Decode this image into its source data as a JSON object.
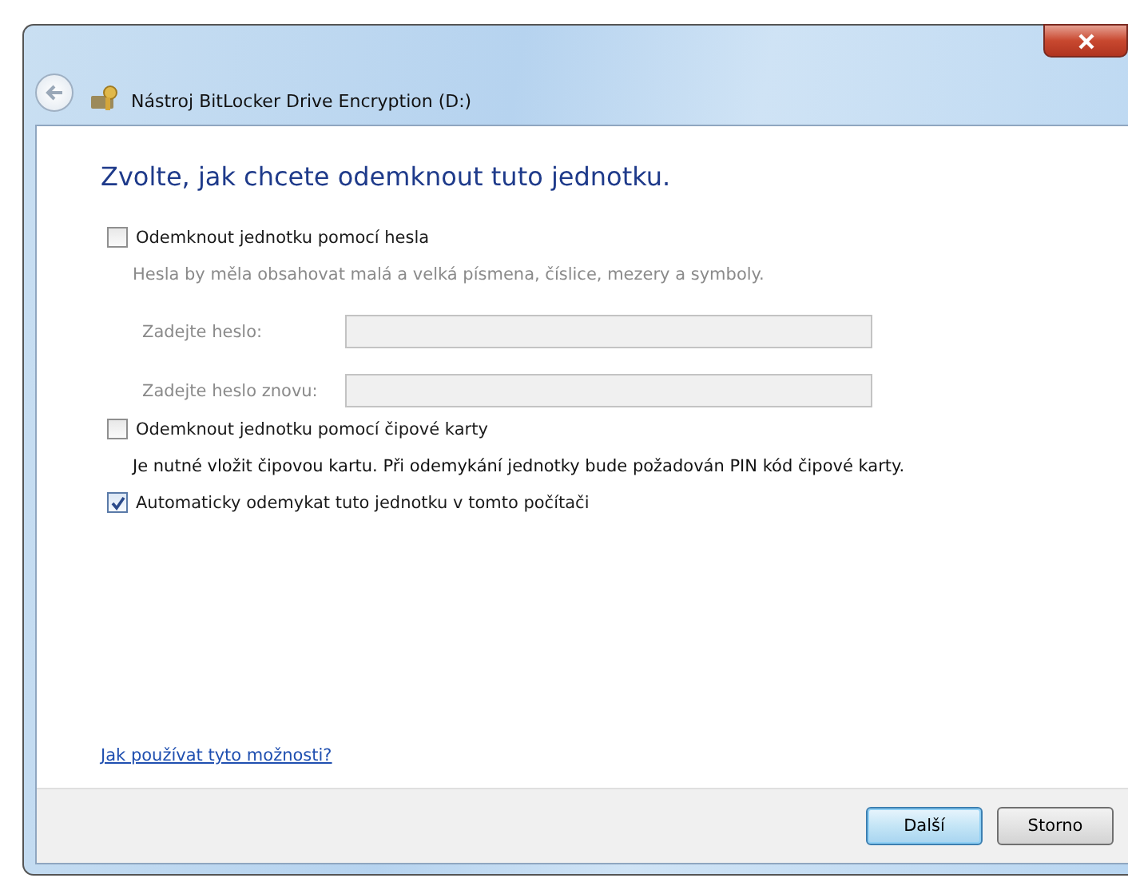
{
  "window": {
    "title": "Nástroj BitLocker Drive Encryption (D:)"
  },
  "heading": "Zvolte, jak chcete odemknout tuto jednotku.",
  "options": [
    {
      "label": "Odemknout jednotku pomocí hesla",
      "checked": false,
      "note": "Hesla by měla obsahovat malá a velká písmena, číslice, mezery a symboly.",
      "note_disabled": true,
      "fields": [
        {
          "label": "Zadejte heslo:",
          "disabled": true
        },
        {
          "label": "Zadejte heslo znovu:",
          "disabled": true
        }
      ]
    },
    {
      "label": "Odemknout jednotku pomocí čipové karty",
      "checked": false,
      "note": "Je nutné vložit čipovou kartu. Při odemykání jednotky bude požadován PIN kód čipové karty.",
      "note_disabled": false
    },
    {
      "label": "Automaticky odemykat tuto jednotku v tomto počítači",
      "checked": true
    }
  ],
  "help_link": "Jak používat tyto možnosti?",
  "buttons": [
    {
      "label": "Další",
      "default": true
    },
    {
      "label": "Storno",
      "default": false
    }
  ]
}
